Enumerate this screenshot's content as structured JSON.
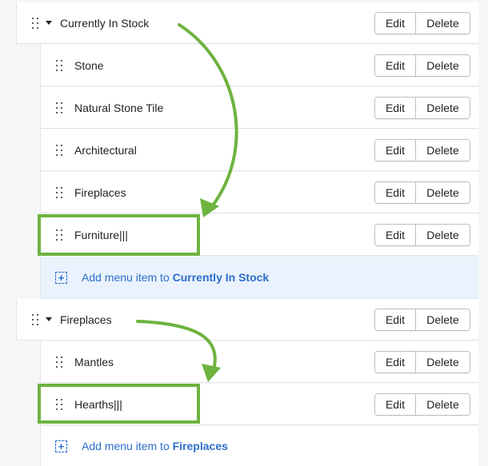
{
  "accent_color": "#6db33f",
  "link_color": "#2c6ecb",
  "buttons": {
    "edit": "Edit",
    "delete": "Delete"
  },
  "groups": [
    {
      "title": "Currently In Stock",
      "items": [
        "Stone",
        "Natural Stone Tile",
        "Architectural",
        "Fireplaces",
        "Furniture|||"
      ],
      "add_prefix": "Add menu item to ",
      "add_target": "Currently In Stock"
    },
    {
      "title": "Fireplaces",
      "items": [
        "Mantles",
        "Hearths|||"
      ],
      "add_prefix": "Add menu item to ",
      "add_target": "Fireplaces"
    }
  ]
}
